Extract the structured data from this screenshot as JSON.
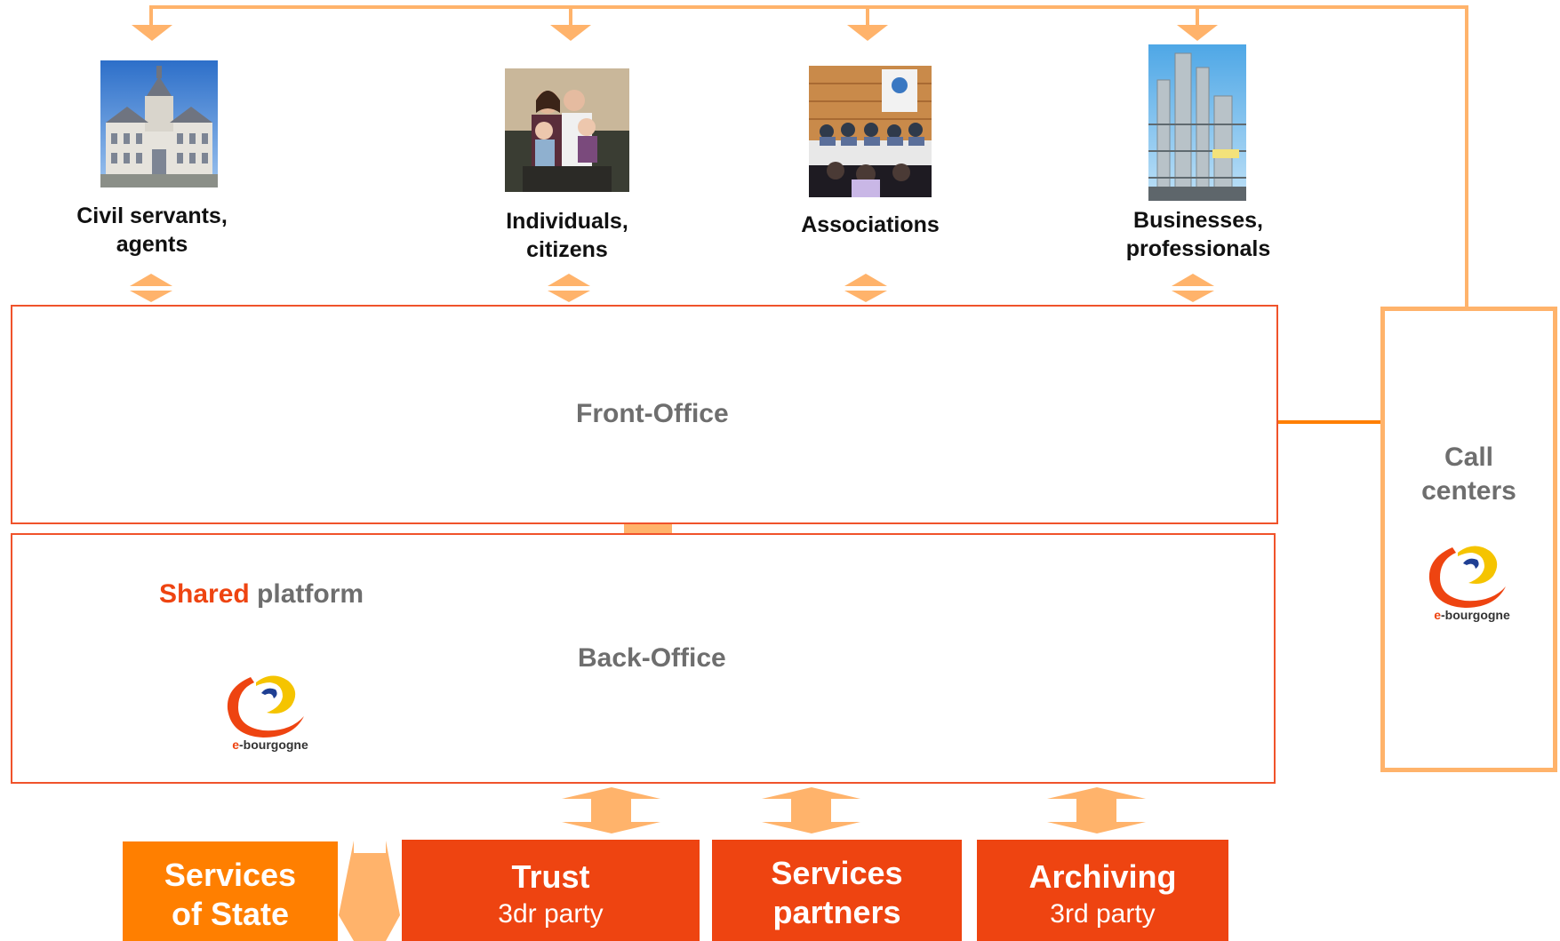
{
  "audiences": [
    {
      "id": "civil",
      "label_l1": "Civil servants,",
      "label_l2": "agents"
    },
    {
      "id": "individuals",
      "label_l1": "Individuals,",
      "label_l2": "citizens"
    },
    {
      "id": "associations",
      "label_l1": "Associations",
      "label_l2": ""
    },
    {
      "id": "businesses",
      "label_l1": "Businesses,",
      "label_l2": "professionals"
    }
  ],
  "front_office": {
    "title": "Front-Office"
  },
  "back_office": {
    "title": "Back-Office",
    "shared_highlight": "Shared",
    "shared_rest": " platform"
  },
  "call_centers": {
    "label_l1": "Call",
    "label_l2": "centers"
  },
  "logo": {
    "prefix": "e",
    "suffix": "-bourgogne"
  },
  "services": [
    {
      "id": "state",
      "line1": "Services",
      "line2": "of State",
      "color": "#ff7f00"
    },
    {
      "id": "trust",
      "line1": "Trust",
      "line2": "3dr party",
      "color": "#ee4411"
    },
    {
      "id": "partners",
      "line1": "Services",
      "line2": "partners",
      "color": "#ee4411"
    },
    {
      "id": "archiving",
      "line1": "Archiving",
      "line2": "3rd party",
      "color": "#ee4411"
    }
  ],
  "colors": {
    "accent_orange": "#ffb36b",
    "red": "#ee4411",
    "box_border": "#f0532b",
    "dark_orange": "#ff7f00",
    "gray_text": "#6e6e6e"
  }
}
